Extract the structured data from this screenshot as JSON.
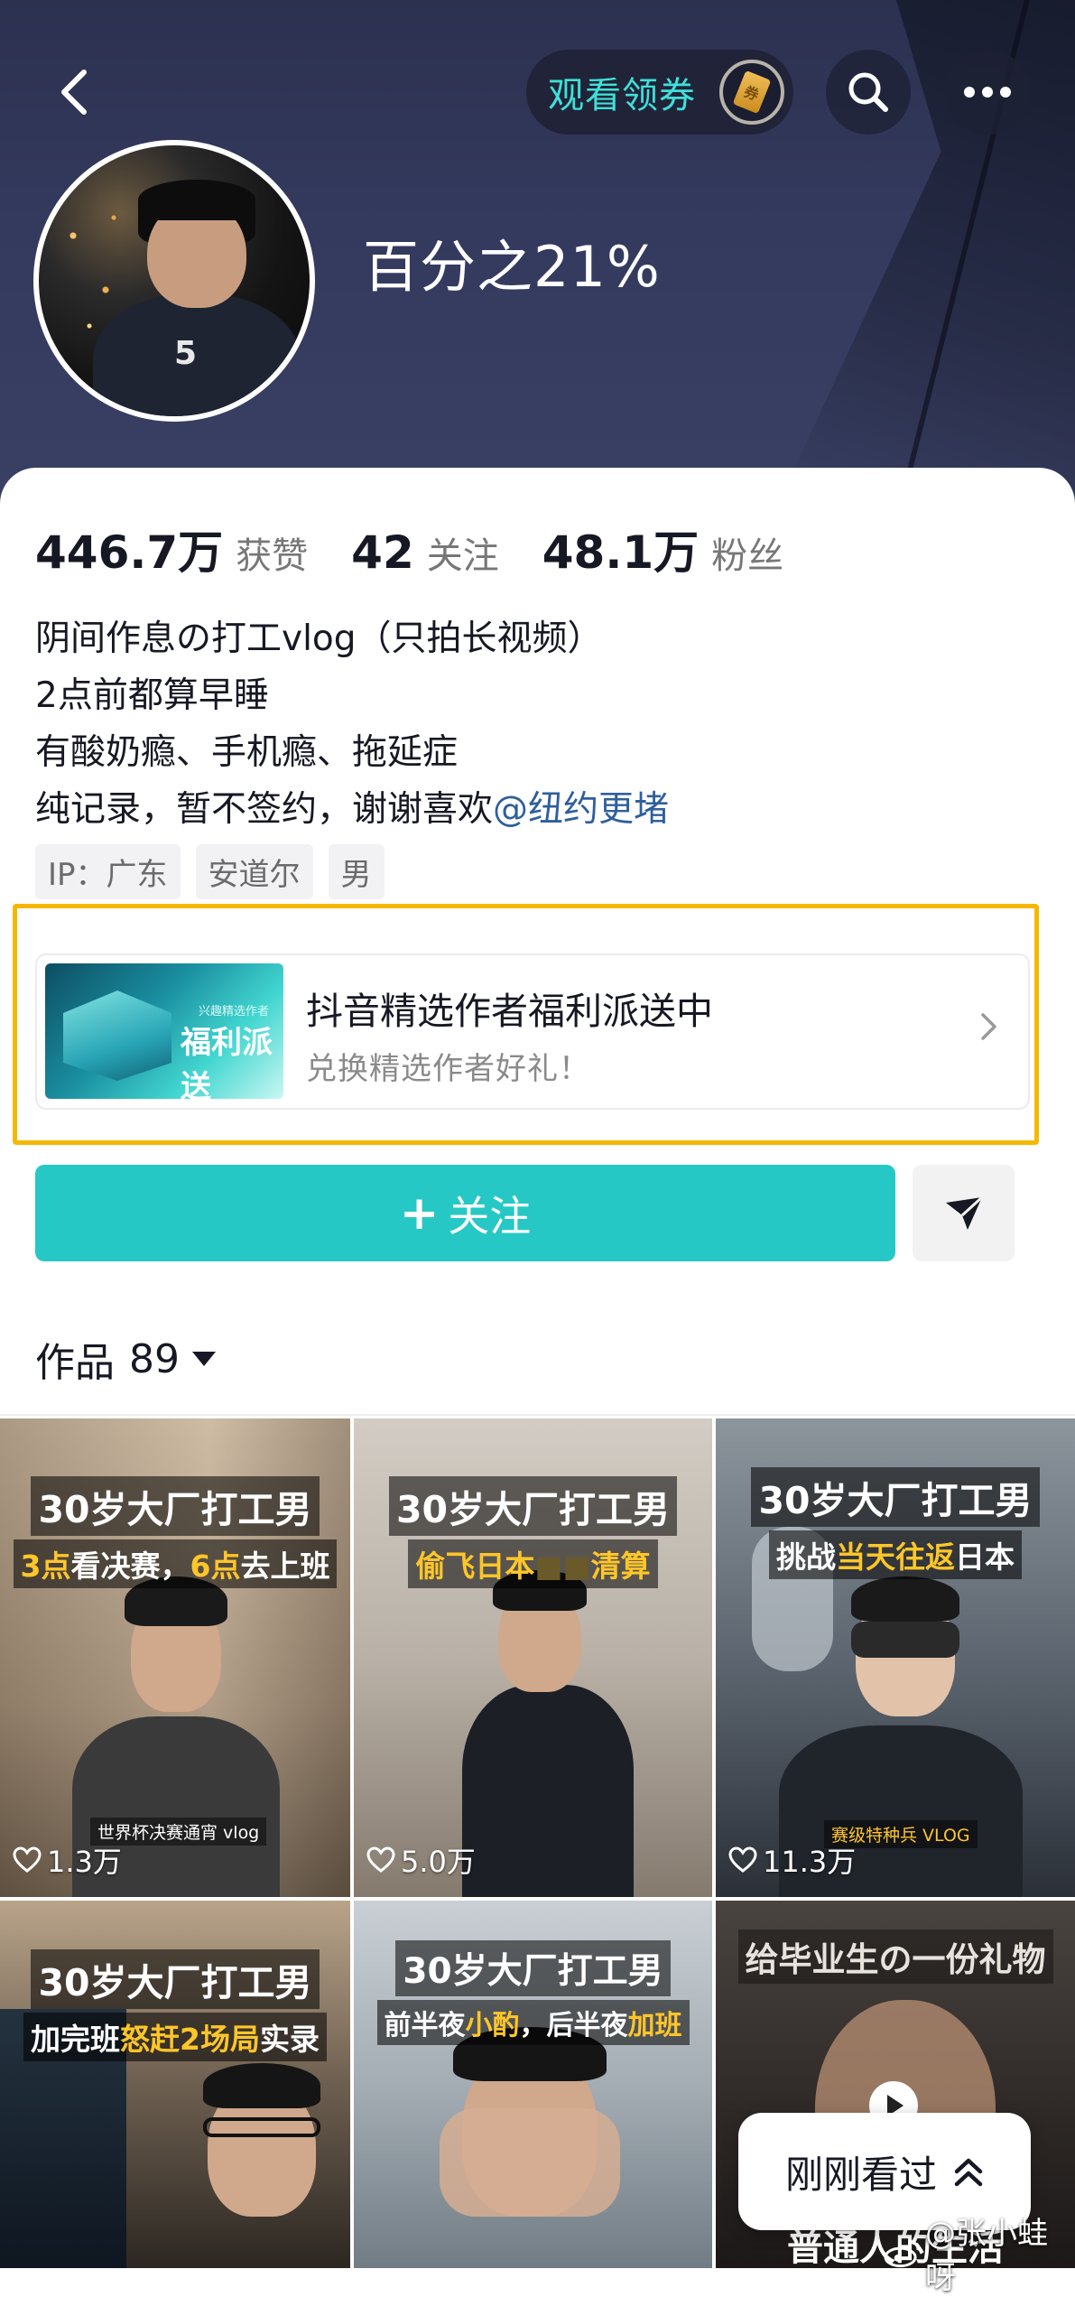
{
  "header": {
    "coupon_label": "观看领券",
    "username": "百分之21%"
  },
  "stats": [
    {
      "value": "446.7万",
      "label": "获赞"
    },
    {
      "value": "42",
      "label": "关注"
    },
    {
      "value": "48.1万",
      "label": "粉丝"
    }
  ],
  "bio": {
    "line1": "阴间作息の打工vlog（只拍长视频）",
    "line2": "2点前都算早睡",
    "line3": "有酸奶瘾、手机瘾、拖延症",
    "line4_text": "纯记录，暂不签约，谢谢喜欢",
    "line4_mention": "@纽约更堵"
  },
  "tags": [
    "IP：广东",
    "安道尔",
    "男"
  ],
  "promo": {
    "image_small": "兴趣精选作者",
    "image_big": "福利派送",
    "title": "抖音精选作者福利派送中",
    "subtitle": "兑换精选作者好礼！"
  },
  "actions": {
    "follow_label": "关注"
  },
  "works": {
    "label": "作品",
    "count": "89"
  },
  "videos": [
    {
      "title": "30岁大厂打工男",
      "sub_a": "3点",
      "sub_b": "看决赛，",
      "sub_c": "6点",
      "sub_d": "去上班",
      "tag": "世界杯决赛通宵 vlog",
      "likes": "1.3万"
    },
    {
      "title": "30岁大厂打工男",
      "sub_a": "偷飞日本",
      "sub_b": "清算",
      "likes": "5.0万"
    },
    {
      "title": "30岁大厂打工男",
      "sub_a": "挑战",
      "sub_b": "当天往返",
      "sub_c": "日本",
      "tag": "赛级特种兵 VLOG",
      "likes": "11.3万"
    },
    {
      "title": "30岁大厂打工男",
      "sub_a": "加完班",
      "sub_b": "怒赶2场局",
      "sub_c": "实录"
    },
    {
      "title": "30岁大厂打工男",
      "sub_a": "前半夜",
      "sub_b": "小酌",
      "sub_c": "，后半夜",
      "sub_d": "加班"
    },
    {
      "title": "给毕业生の一份礼物",
      "bottom": "普通人的生活"
    }
  ],
  "recent_label": "刚刚看过",
  "watermark": "@张小蛙呀"
}
